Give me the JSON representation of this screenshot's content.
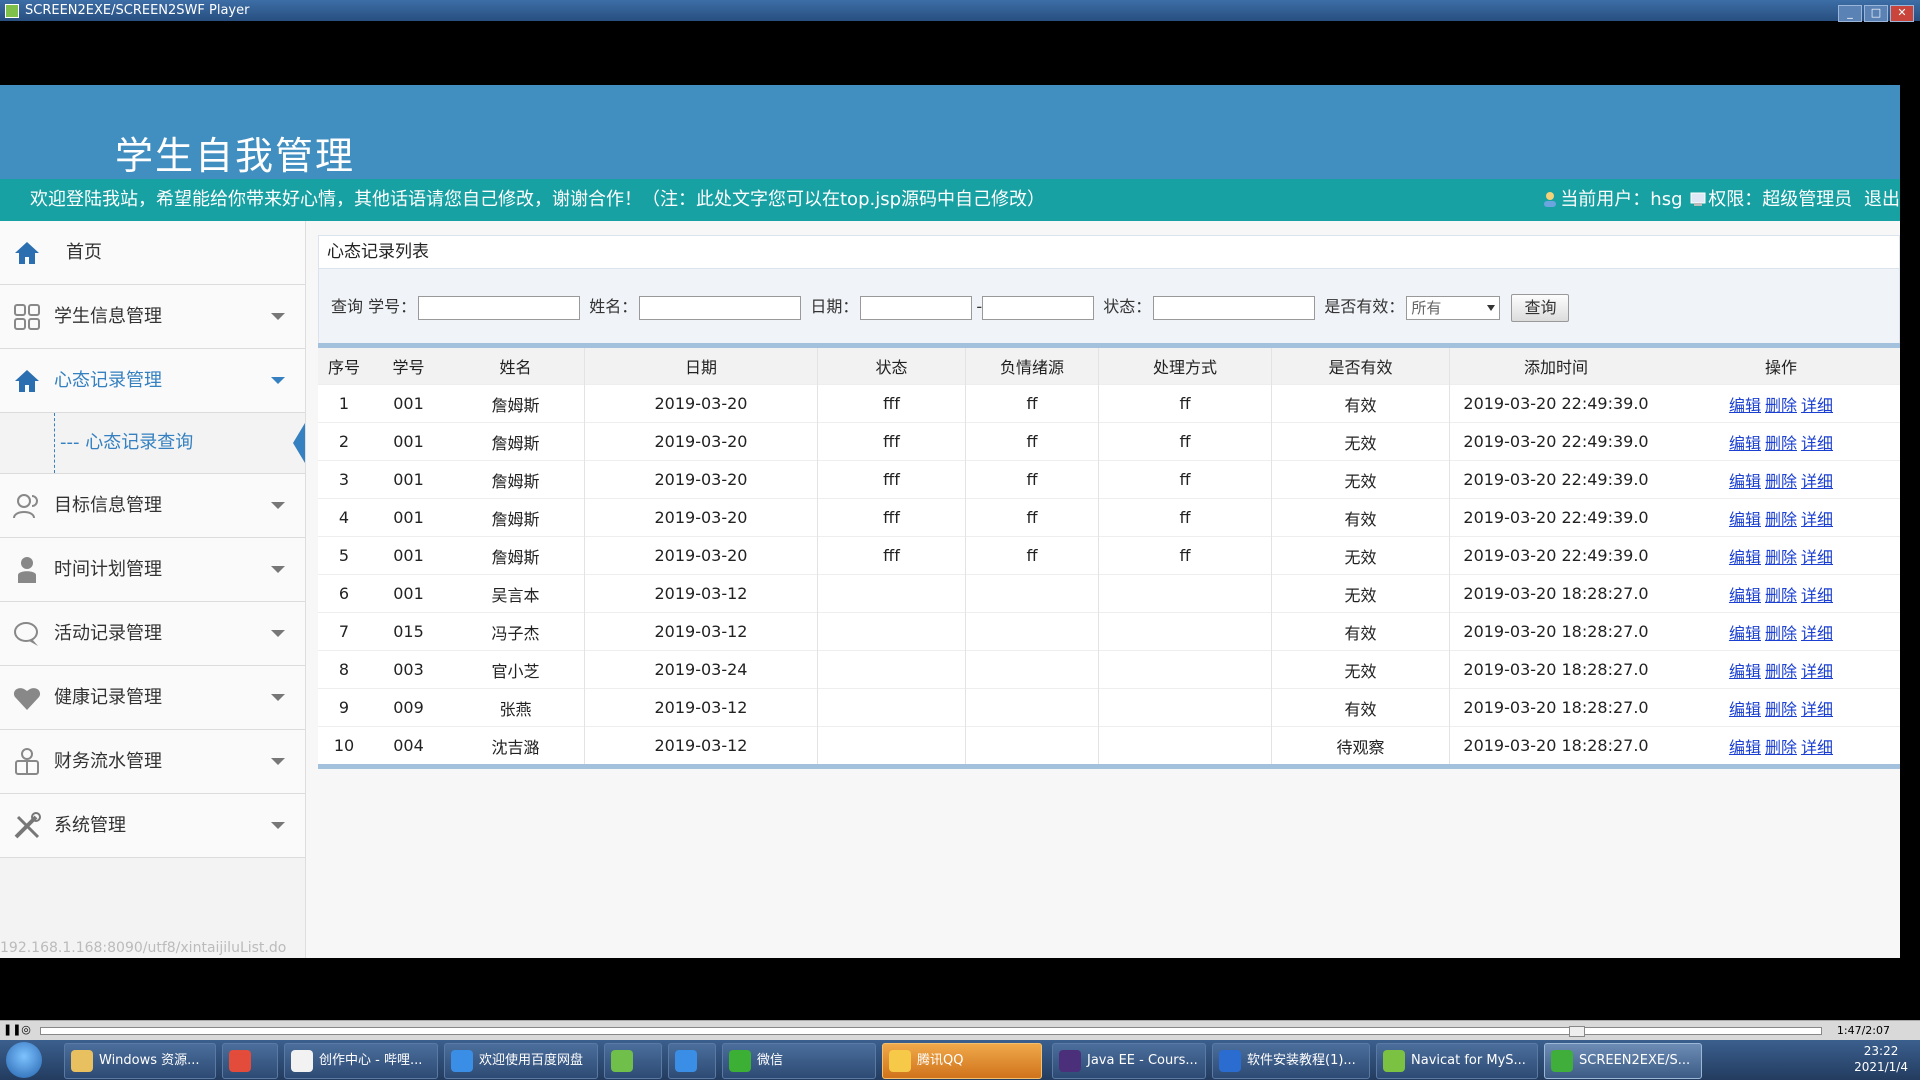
{
  "window": {
    "title": "SCREEN2EXE/SCREEN2SWF Player"
  },
  "header": {
    "site_title": "学生自我管理"
  },
  "welcome": {
    "message": "欢迎登陆我站，希望能给你带来好心情，其他话语请您自己修改，谢谢合作！（注：此处文字您可以在top.jsp源码中自己修改）",
    "user_label": "当前用户：hsg",
    "role_label": "权限：超级管理员",
    "logout": "退出"
  },
  "sidebar": {
    "items": [
      {
        "label": "首页",
        "icon": "home-icon"
      },
      {
        "label": "学生信息管理",
        "icon": "grid-icon"
      },
      {
        "label": "心态记录管理",
        "icon": "home-icon"
      },
      {
        "label": "目标信息管理",
        "icon": "users-icon"
      },
      {
        "label": "时间计划管理",
        "icon": "person-icon"
      },
      {
        "label": "活动记录管理",
        "icon": "chat-icon"
      },
      {
        "label": "健康记录管理",
        "icon": "heart-icon"
      },
      {
        "label": "财务流水管理",
        "icon": "finance-icon"
      },
      {
        "label": "系统管理",
        "icon": "tools-icon"
      }
    ],
    "sub_item": "心态记录查询"
  },
  "panel": {
    "title": "心态记录列表"
  },
  "query": {
    "prefix": "查询",
    "student_no_label": "学号：",
    "name_label": "姓名：",
    "date_label": "日期：",
    "date_sep": "-",
    "status_label": "状态：",
    "valid_label": "是否有效：",
    "valid_value": "所有",
    "button": "查询"
  },
  "table": {
    "headers": [
      "序号",
      "学号",
      "姓名",
      "日期",
      "状态",
      "负情绪源",
      "处理方式",
      "是否有效",
      "添加时间",
      "操作"
    ],
    "ops": {
      "edit": "编辑",
      "delete": "删除",
      "detail": "详细"
    },
    "rows": [
      [
        "1",
        "001",
        "詹姆斯",
        "2019-03-20",
        "fff",
        "ff",
        "ff",
        "有效",
        "2019-03-20 22:49:39.0"
      ],
      [
        "2",
        "001",
        "詹姆斯",
        "2019-03-20",
        "fff",
        "ff",
        "ff",
        "无效",
        "2019-03-20 22:49:39.0"
      ],
      [
        "3",
        "001",
        "詹姆斯",
        "2019-03-20",
        "fff",
        "ff",
        "ff",
        "无效",
        "2019-03-20 22:49:39.0"
      ],
      [
        "4",
        "001",
        "詹姆斯",
        "2019-03-20",
        "fff",
        "ff",
        "ff",
        "有效",
        "2019-03-20 22:49:39.0"
      ],
      [
        "5",
        "001",
        "詹姆斯",
        "2019-03-20",
        "fff",
        "ff",
        "ff",
        "无效",
        "2019-03-20 22:49:39.0"
      ],
      [
        "6",
        "001",
        "吴言本",
        "2019-03-12",
        "",
        "",
        "",
        "无效",
        "2019-03-20 18:28:27.0"
      ],
      [
        "7",
        "015",
        "冯子杰",
        "2019-03-12",
        "",
        "",
        "",
        "有效",
        "2019-03-20 18:28:27.0"
      ],
      [
        "8",
        "003",
        "官小芝",
        "2019-03-24",
        "",
        "",
        "",
        "无效",
        "2019-03-20 18:28:27.0"
      ],
      [
        "9",
        "009",
        "张燕",
        "2019-03-12",
        "",
        "",
        "",
        "有效",
        "2019-03-20 18:28:27.0"
      ],
      [
        "10",
        "004",
        "沈吉潞",
        "2019-03-12",
        "",
        "",
        "",
        "待观察",
        "2019-03-20 18:28:27.0"
      ]
    ]
  },
  "status_url": "192.168.1.168:8090/utf8/xintaijiluList.do",
  "player": {
    "time": "1:47/2:07"
  },
  "taskbar": {
    "items": [
      {
        "label": "Windows 资源...",
        "color": "#e8c060"
      },
      {
        "label": "",
        "color": "#e34b3a"
      },
      {
        "label": "创作中心 - 哔哩...",
        "color": "#f2f2f2"
      },
      {
        "label": "欢迎使用百度网盘",
        "color": "#3a8ee6"
      },
      {
        "label": "",
        "color": "#6fbf4a"
      },
      {
        "label": "",
        "color": "#3a8ee6"
      },
      {
        "label": "微信",
        "color": "#3cb034"
      },
      {
        "label": "腾讯QQ",
        "color": "#f7c948"
      },
      {
        "label": "Java EE - Cours...",
        "color": "#4b2f7a"
      },
      {
        "label": "软件安装教程(1)...",
        "color": "#2b6cd1"
      },
      {
        "label": "Navicat for MyS...",
        "color": "#7cc242"
      },
      {
        "label": "SCREEN2EXE/S...",
        "color": "#3fae3a"
      }
    ],
    "time": "23:22",
    "date": "2021/1/4"
  }
}
